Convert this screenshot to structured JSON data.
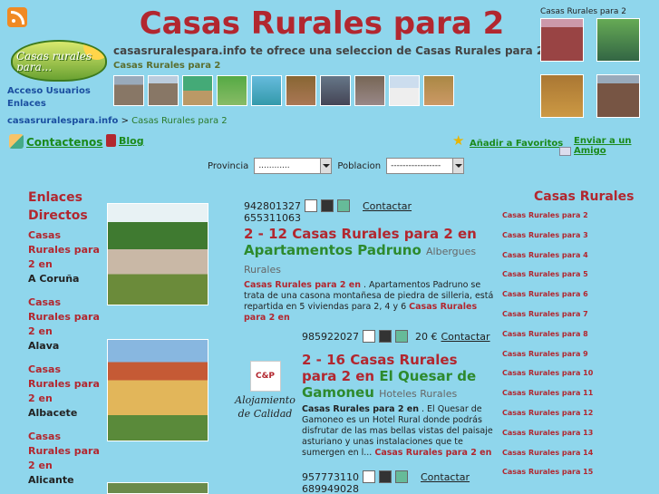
{
  "header": {
    "title": "Casas Rurales para 2",
    "subtitle": "casasruralespara.info te ofrece una seleccion de Casas Rurales para 2",
    "strip_label": "Casas Rurales para 2",
    "side_label": "Casas Rurales para 2",
    "logo_text": "Casas rurales para..."
  },
  "topnav": {
    "login": "Acceso Usuarios",
    "links": "Enlaces"
  },
  "breadcrumb": {
    "host": "casasruralespara.info",
    "sep": ">",
    "current": "Casas Rurales para 2"
  },
  "toolbar": {
    "contact": "Contactenos",
    "blog": "Blog",
    "favorites": "Añadir a Favoritos",
    "send_friend": "Enviar a un Amigo"
  },
  "filters": {
    "province_label": "Provincia",
    "province_value": "............",
    "town_label": "Poblacion",
    "town_value": "-----------------"
  },
  "left_nav": {
    "heading": "Enlaces Directos",
    "items": [
      {
        "link": "Casas Rurales para 2 en",
        "place": "A Coruña"
      },
      {
        "link": "Casas Rurales para 2 en",
        "place": "Alava"
      },
      {
        "link": "Casas Rurales para 2 en",
        "place": "Albacete"
      },
      {
        "link": "Casas Rurales para 2 en",
        "place": "Alicante"
      }
    ]
  },
  "listings": [
    {
      "phone": "942801327",
      "phone2": "655311063",
      "price": "",
      "contact": "Contactar",
      "title": "2 - 12 Casas Rurales para 2 en",
      "name": "Apartamentos Padruno",
      "category": "Albergues Rurales",
      "desc_lead": "Casas Rurales para 2 en",
      "desc": ". Apartamentos Padruno se trata de una casona montañesa de piedra de silleria, está repartida en 5 viviendas para 2, 4 y 6",
      "desc_tail": "Casas Rurales para 2 en"
    },
    {
      "phone": "985922027",
      "phone2": "",
      "price": "20 €",
      "contact": "Contactar",
      "title": "2 - 16 Casas Rurales para 2 en",
      "name": "El Quesar de Gamoneu",
      "category": "Hoteles Rurales",
      "badge_text": "Alojamiento de Calidad",
      "badge_logo": "C&P",
      "desc_lead": "Casas Rurales para 2 en",
      "desc": ". El Quesar de Gamoneo es un Hotel Rural donde podrás disfrutar de las mas bellas vistas del paisaje asturiano y unas instalaciones que te sumergen en l...",
      "desc_tail": "Casas Rurales para 2 en"
    },
    {
      "phone": "957773110",
      "phone2": "689949028",
      "price": "",
      "contact": "Contactar"
    }
  ],
  "right_nav": {
    "heading": "Casas Rurales",
    "items": [
      "Casas Rurales para 2",
      "Casas Rurales para 3",
      "Casas Rurales para 4",
      "Casas Rurales para 5",
      "Casas Rurales para 6",
      "Casas Rurales para 7",
      "Casas Rurales para 8",
      "Casas Rurales para 9",
      "Casas Rurales para 10",
      "Casas Rurales para 11",
      "Casas Rurales para 12",
      "Casas Rurales para 13",
      "Casas Rurales para 14",
      "Casas Rurales para 15"
    ]
  },
  "colors": {
    "background": "#8fd6ec",
    "title": "#b2272f",
    "accent_green": "#2d8a2d",
    "link_blue": "#1b4fa0"
  }
}
